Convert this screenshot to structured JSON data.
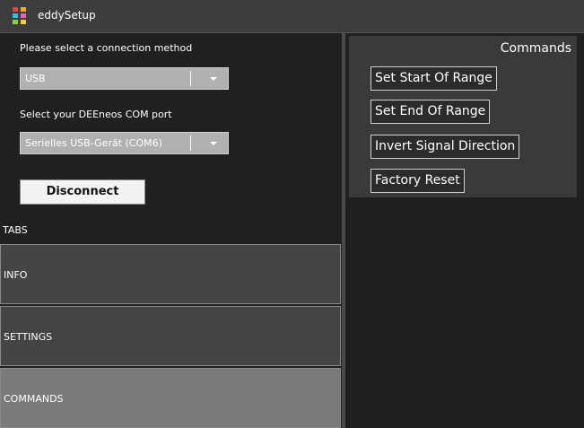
{
  "window": {
    "title": "eddySetup"
  },
  "connection": {
    "method_label": "Please select a connection method",
    "method_value": "USB",
    "port_label": "Select your DEEneos COM port",
    "port_value": "Serielles USB-Gerät (COM6)",
    "disconnect_label": "Disconnect"
  },
  "tabs": {
    "header": "TABS",
    "items": [
      {
        "label": "INFO"
      },
      {
        "label": "SETTINGS"
      },
      {
        "label": "COMMANDS"
      }
    ],
    "selected": "COMMANDS"
  },
  "commands": {
    "title": "Commands",
    "buttons": [
      {
        "label": "Set Start Of Range"
      },
      {
        "label": "Set End Of Range"
      },
      {
        "label": "Invert Signal Direction"
      },
      {
        "label": "Factory Reset"
      }
    ]
  },
  "icons": {
    "app_logo": "eddysetup-logo-icon",
    "dropdown": "chevron-down-icon"
  },
  "colors": {
    "titlebar": "#3d3d3d",
    "background": "#1f1f1f",
    "combo": "#b1b1b1",
    "tab": "#444444",
    "tab_selected": "#7a7a7a",
    "commands_panel": "#3a3a3a",
    "logo": [
      "#e8403a",
      "#f5a623",
      "#2dc0e8",
      "#e85fc4",
      "#8bd13a",
      "#f2d230"
    ]
  }
}
